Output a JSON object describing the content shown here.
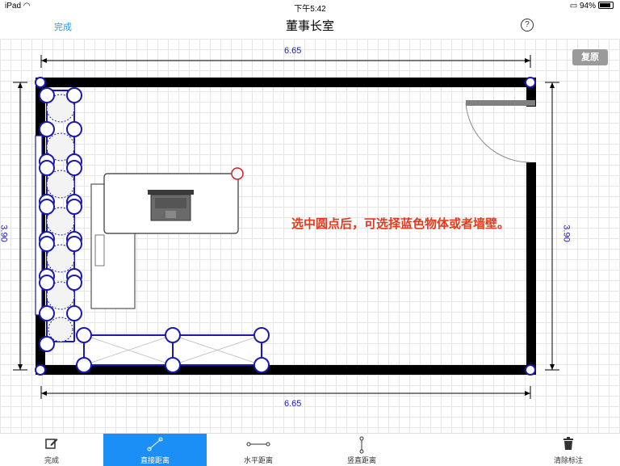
{
  "status": {
    "device": "iPad",
    "time": "下午5:42",
    "battery": "94%"
  },
  "nav": {
    "done": "完成",
    "title": "董事长室",
    "help": "?"
  },
  "toolbar": {
    "restore": "复原"
  },
  "dimensions": {
    "top": "6.65",
    "bottom": "6.65",
    "left": "3.90",
    "right": "3.90"
  },
  "annotation": {
    "text": "选中圆点后，可选择蓝色物体或者墙壁。"
  },
  "tabs": [
    {
      "label": "完成",
      "icon": "edit-icon"
    },
    {
      "label": "直接距离",
      "icon": "diagonal-line-icon",
      "active": true
    },
    {
      "label": "水平距离",
      "icon": "horizontal-line-icon"
    },
    {
      "label": "竖直距离",
      "icon": "vertical-line-icon"
    },
    {
      "label": "清除标注",
      "icon": "trash-icon"
    }
  ],
  "colors": {
    "accent": "#1b8ff5",
    "note": "#e43a1c",
    "dimension": "#1a1ab0",
    "handle": "#1a1ab0",
    "selected_handle": "#d0202a"
  }
}
